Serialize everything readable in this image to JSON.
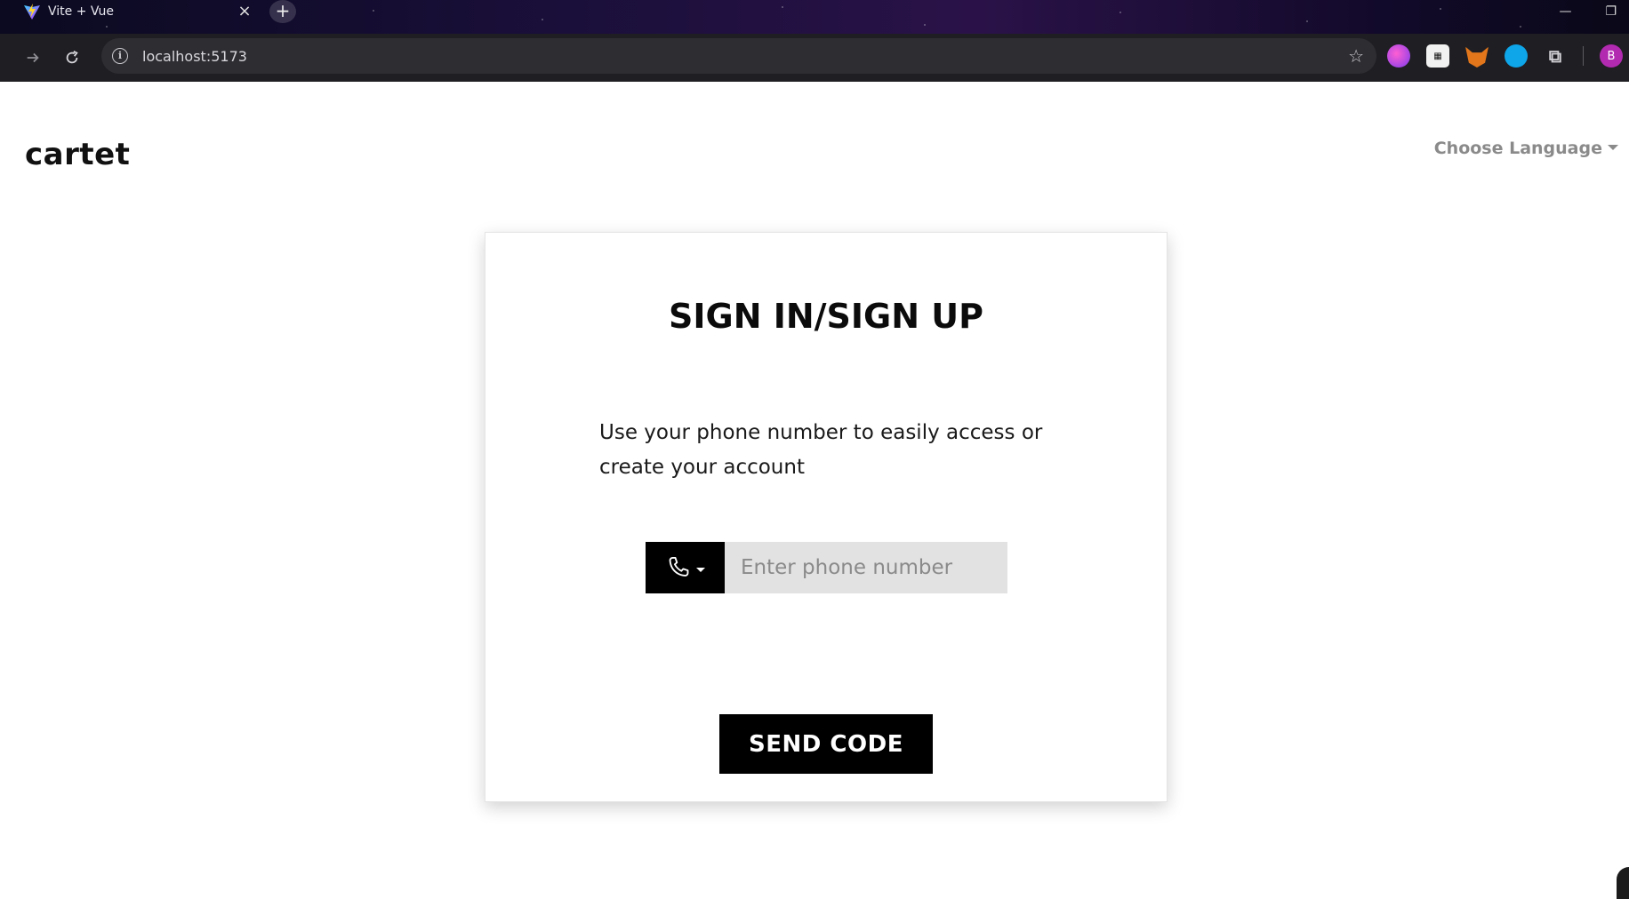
{
  "browser": {
    "tab_title": "Vite + Vue",
    "tab_close": "×",
    "new_tab": "+",
    "url": "localhost:5173",
    "min_label": "—",
    "restore_label": "❐",
    "profile_initial": "B",
    "extensions": [
      "brain-icon",
      "qr-code-icon",
      "metamask-fox-icon",
      "refresh-circle-icon",
      "puzzle-icon"
    ]
  },
  "header": {
    "brand": "cartet",
    "language_label": "Choose Language"
  },
  "card": {
    "title": "SIGN IN/SIGN UP",
    "description": "Use your phone number to easily access or create your account",
    "phone_placeholder": "Enter phone number",
    "send_button": "SEND CODE"
  }
}
